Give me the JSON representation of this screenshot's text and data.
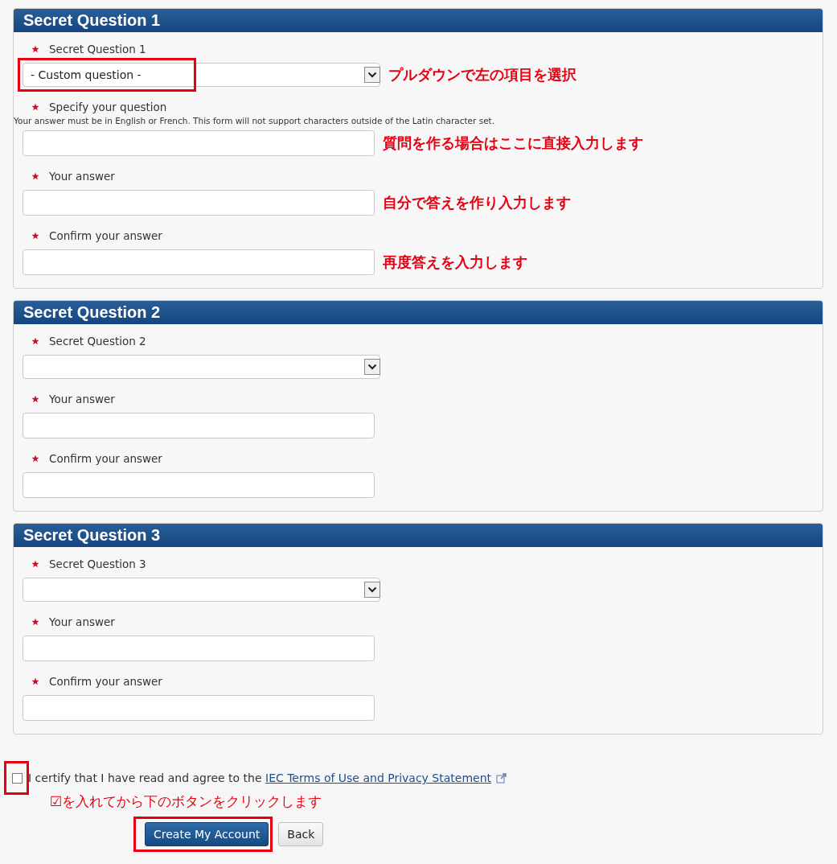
{
  "sections": [
    {
      "title": "Secret Question 1",
      "fields": [
        {
          "kind": "select",
          "label": "Secret Question 1",
          "required": true,
          "value": "- Custom question -",
          "highlighted": true,
          "annotation": "プルダウンで左の項目を選択"
        },
        {
          "kind": "text",
          "label": "Specify your question",
          "required": true,
          "note": "Your answer must be in English or French. This form will not support characters outside of the Latin character set.",
          "highlighted": false,
          "annotation": "質問を作る場合はここに直接入力します"
        },
        {
          "kind": "text",
          "label": "Your answer",
          "required": true,
          "highlighted": false,
          "annotation": "自分で答えを作り入力します"
        },
        {
          "kind": "text",
          "label": "Confirm your answer",
          "required": true,
          "highlighted": false,
          "annotation": "再度答えを入力します"
        }
      ]
    },
    {
      "title": "Secret Question 2",
      "fields": [
        {
          "kind": "select",
          "label": "Secret Question 2",
          "required": true,
          "highlighted": false
        },
        {
          "kind": "text",
          "label": "Your answer",
          "required": true,
          "highlighted": false
        },
        {
          "kind": "text",
          "label": "Confirm your answer",
          "required": true,
          "highlighted": false
        }
      ]
    },
    {
      "title": "Secret Question 3",
      "fields": [
        {
          "kind": "select",
          "label": "Secret Question 3",
          "required": true,
          "highlighted": false
        },
        {
          "kind": "text",
          "label": "Your answer",
          "required": true,
          "highlighted": false
        },
        {
          "kind": "text",
          "label": "Confirm your answer",
          "required": true,
          "highlighted": false
        }
      ]
    }
  ],
  "agreement": {
    "checked": false,
    "highlighted": true,
    "text": "I certify that I have read and agree to the ",
    "link": "IEC Terms of Use and Privacy Statement",
    "annotation": "☑を入れてから下のボタンをクリックします"
  },
  "buttons": [
    {
      "kind": "primary",
      "label": "Create My Account",
      "highlighted": true
    },
    {
      "kind": "secondary",
      "label": "Back",
      "highlighted": false
    }
  ]
}
